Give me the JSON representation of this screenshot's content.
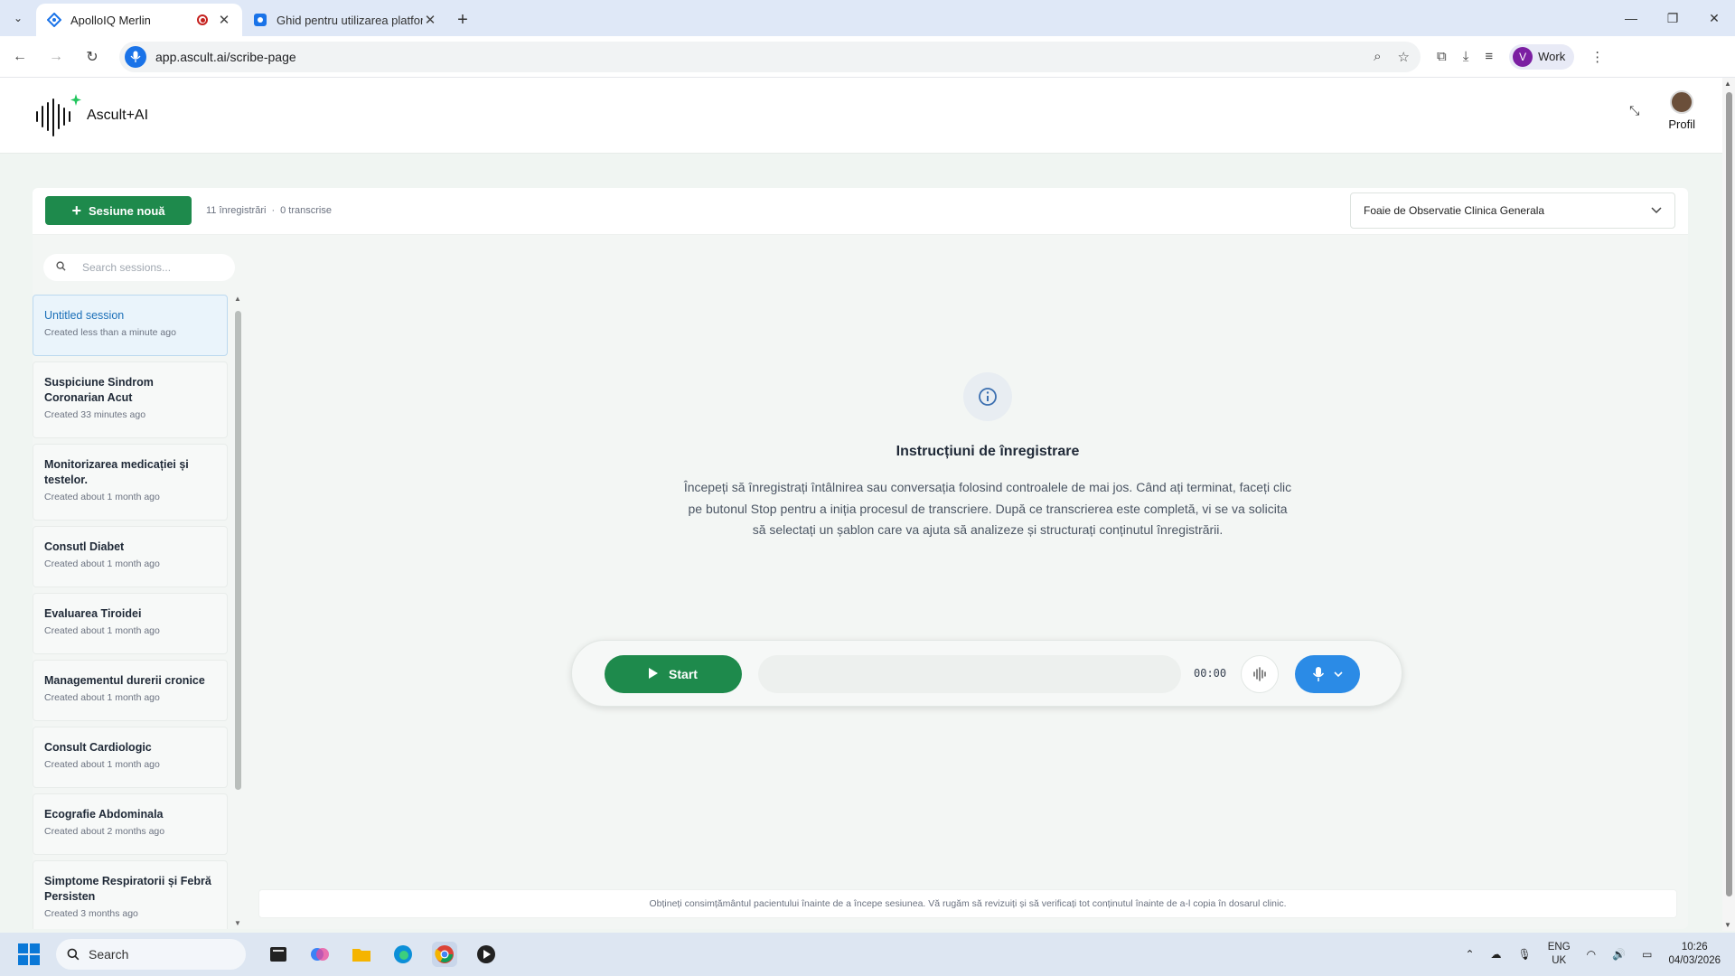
{
  "browser": {
    "tabs": [
      {
        "title": "ApolloIQ Merlin",
        "active": true
      },
      {
        "title": "Ghid pentru utilizarea platform",
        "active": false
      }
    ],
    "url": "app.ascult.ai/scribe-page",
    "profile_label": "Work",
    "profile_initial": "V"
  },
  "app": {
    "logo_text": "Ascult+AI",
    "profile_label": "Profil"
  },
  "toolbar": {
    "new_session_label": "Sesiune nouă",
    "recordings_count": "11 înregistrări",
    "transcripts_count": "0 transcrise",
    "template_selected": "Foaie de Observatie Clinica Generala"
  },
  "sidebar": {
    "search_placeholder": "Search sessions...",
    "sessions": [
      {
        "title": "Untitled session",
        "created": "Created less than a minute ago"
      },
      {
        "title": "Suspiciune Sindrom Coronarian Acut",
        "created": "Created 33 minutes ago"
      },
      {
        "title": "Monitorizarea medicației și testelor.",
        "created": "Created about 1 month ago"
      },
      {
        "title": "Consutl Diabet",
        "created": "Created about 1 month ago"
      },
      {
        "title": "Evaluarea Tiroidei",
        "created": "Created about 1 month ago"
      },
      {
        "title": "Managementul durerii cronice",
        "created": "Created about 1 month ago"
      },
      {
        "title": "Consult Cardiologic",
        "created": "Created about 1 month ago"
      },
      {
        "title": "Ecografie Abdominala",
        "created": "Created about 2 months ago"
      },
      {
        "title": "Simptome Respiratorii și Febră Persisten",
        "created": "Created 3 months ago"
      }
    ]
  },
  "instructions": {
    "title": "Instrucțiuni de înregistrare",
    "body": "Începeți să înregistrați întâlnirea sau conversația folosind controalele de mai jos. Când ați terminat, faceți clic pe butonul Stop pentru a iniția procesul de transcriere. După ce transcrierea este completă, vi se va solicita să selectați un șablon care va ajuta să analizeze și structurați conținutul înregistrării."
  },
  "recorder": {
    "start_label": "Start",
    "timer": "00:00"
  },
  "footer": {
    "notice": "Obțineți consimțământul pacientului înainte de a începe sesiunea. Vă rugăm să revizuiți și să verificați tot conținutul înainte de a-l copia în dosarul clinic."
  },
  "taskbar": {
    "search_label": "Search",
    "lang_line1": "ENG",
    "lang_line2": "UK",
    "time": "10:26",
    "date": "04/03/2026"
  },
  "colors": {
    "brand_green": "#1e8a4c",
    "mic_blue": "#2b8be6",
    "active_session_text": "#1b6fb8"
  }
}
